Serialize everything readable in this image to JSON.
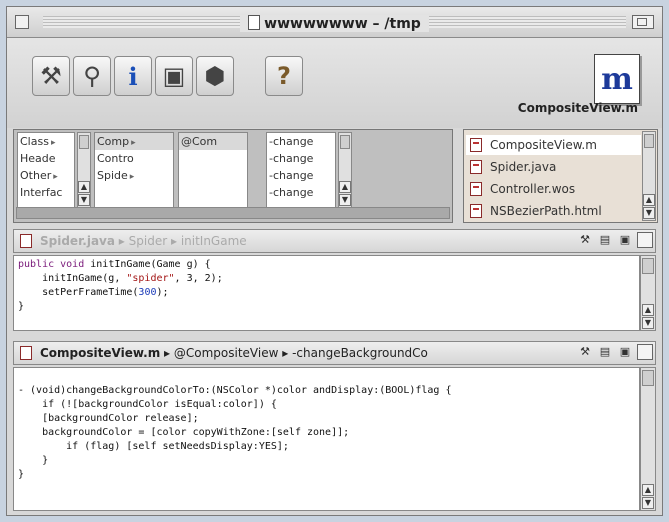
{
  "window": {
    "title": "wwwwwwww – /tmp"
  },
  "toolbar": {
    "buttons": [
      {
        "name": "hammer-icon",
        "glyph": "⚒"
      },
      {
        "name": "magnifier-icon",
        "glyph": "⚲"
      },
      {
        "name": "info-icon",
        "glyph": "i"
      },
      {
        "name": "monitor-icon",
        "glyph": "▣"
      },
      {
        "name": "cube-icon",
        "glyph": "⬢"
      },
      {
        "name": "help-book-icon",
        "glyph": "?"
      }
    ],
    "file_badge_glyph": "m",
    "file_name": "CompositeView.m"
  },
  "browser": {
    "col1": [
      "Class r",
      "Heade",
      "Other r",
      "Interfac"
    ],
    "col2": [
      "Comp r",
      "Contro",
      "Spide r"
    ],
    "col3": [
      "@Com"
    ],
    "col4": [
      "-change",
      "-change",
      "-change",
      "-change"
    ],
    "arrow_glyph": "▸"
  },
  "files": {
    "items": [
      "CompositeView.m",
      "Spider.java",
      "Controller.wos",
      "NSBezierPath.html"
    ]
  },
  "pane1": {
    "file": "Spider.java",
    "sep1": " ▸ ",
    "class": "Spider",
    "sep2": " ▸ ",
    "method": "initInGame",
    "code": {
      "l1_kw": "public void",
      "l1_rest": " initInGame(Game g) {",
      "l2_pre": "    initInGame(g, ",
      "l2_str": "\"spider\"",
      "l2_post": ", 3, 2);",
      "l3_pre": "    setPerFrameTime(",
      "l3_num": "300",
      "l3_post": ");",
      "l4": "}"
    }
  },
  "pane2": {
    "file": "CompositeView.m",
    "sep1": " ▸ ",
    "class": "@CompositeView",
    "sep2": " ▸ ",
    "method": "-changeBackgroundCo",
    "code": {
      "l1": "- (void)changeBackgroundColorTo:(NSColor *)color andDisplay:(BOOL)flag {",
      "l2": "    if (![backgroundColor isEqual:color]) {",
      "l3": "    [backgroundColor release];",
      "l4": "    backgroundColor = [color copyWithZone:[self zone]];",
      "l5": "        if (flag) [self setNeedsDisplay:YES];",
      "l6": "    }",
      "l7": "}"
    }
  },
  "pane_controls": {
    "hammer": "⚒",
    "doc": "▤",
    "monitor": "▣",
    "box": ""
  }
}
